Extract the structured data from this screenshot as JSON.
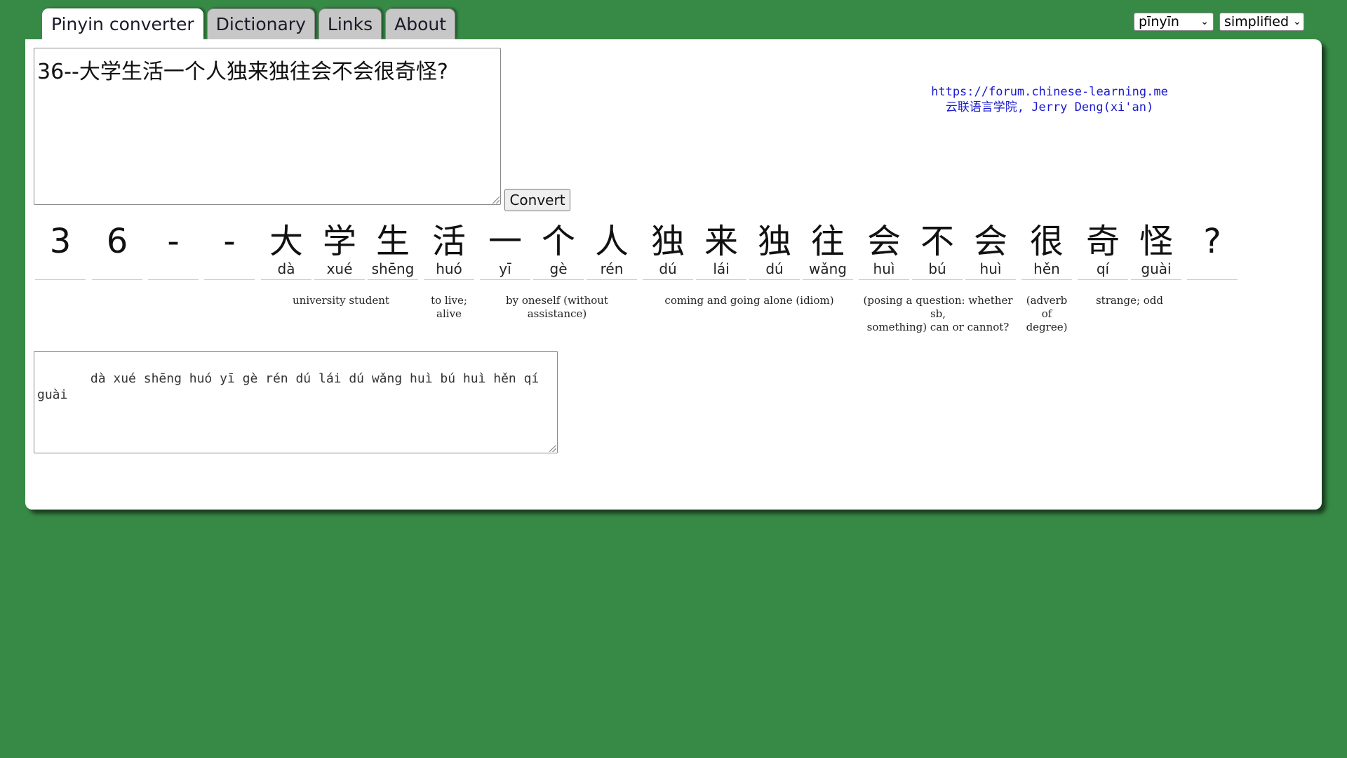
{
  "tabs": [
    {
      "label": "Pinyin converter",
      "active": true
    },
    {
      "label": "Dictionary",
      "active": false
    },
    {
      "label": "Links",
      "active": false
    },
    {
      "label": "About",
      "active": false
    }
  ],
  "selects": {
    "pinyin_style": "pīnyīn",
    "script": "simplified"
  },
  "input": {
    "value": "36--大学生活一个人独来独往会不会很奇怪?"
  },
  "convert_label": "Convert",
  "credits": {
    "line1": "https://forum.chinese-learning.me",
    "line2": "云联语言学院, Jerry Deng(xi'an)"
  },
  "characters": [
    {
      "hanzi": "3",
      "pinyin": ""
    },
    {
      "hanzi": "6",
      "pinyin": ""
    },
    {
      "hanzi": "-",
      "pinyin": ""
    },
    {
      "hanzi": "-",
      "pinyin": ""
    },
    {
      "hanzi": "大",
      "pinyin": "dà"
    },
    {
      "hanzi": "学",
      "pinyin": "xué"
    },
    {
      "hanzi": "生",
      "pinyin": "shēng"
    },
    {
      "hanzi": "活",
      "pinyin": "huó"
    },
    {
      "hanzi": "一",
      "pinyin": "yī"
    },
    {
      "hanzi": "个",
      "pinyin": "gè"
    },
    {
      "hanzi": "人",
      "pinyin": "rén"
    },
    {
      "hanzi": "独",
      "pinyin": "dú"
    },
    {
      "hanzi": "来",
      "pinyin": "lái"
    },
    {
      "hanzi": "独",
      "pinyin": "dú"
    },
    {
      "hanzi": "往",
      "pinyin": "wǎng"
    },
    {
      "hanzi": "会",
      "pinyin": "huì"
    },
    {
      "hanzi": "不",
      "pinyin": "bú"
    },
    {
      "hanzi": "会",
      "pinyin": "huì"
    },
    {
      "hanzi": "很",
      "pinyin": "hěn"
    },
    {
      "hanzi": "奇",
      "pinyin": "qí"
    },
    {
      "hanzi": "怪",
      "pinyin": "guài"
    },
    {
      "hanzi": "?",
      "pinyin": ""
    }
  ],
  "definitions": [
    {
      "text": "university student"
    },
    {
      "text": "to live;\nalive"
    },
    {
      "text": "by oneself (without assistance)"
    },
    {
      "text": "coming and going alone (idiom)"
    },
    {
      "text": "(posing a question: whether sb,\nsomething) can or cannot?"
    },
    {
      "text": "(adverb of\ndegree)"
    },
    {
      "text": "strange; odd"
    }
  ],
  "output": {
    "value": "   dà xué shēng huó yī gè rén dú lái dú wǎng huì bú huì hěn qí guài"
  }
}
